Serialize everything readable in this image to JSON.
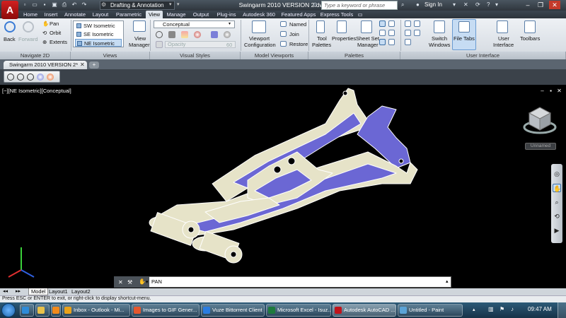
{
  "app": {
    "logo_letter": "A",
    "workspace": "Drafting & Annotation",
    "document_title": "Swingarm 2010 VERSION 2.dwg",
    "search_placeholder": "Type a keyword or phrase",
    "signin_label": "Sign In"
  },
  "ribbon_tabs": [
    "Home",
    "Insert",
    "Annotate",
    "Layout",
    "Parametric",
    "View",
    "Manage",
    "Output",
    "Plug-ins",
    "Autodesk 360",
    "Featured Apps",
    "Express Tools"
  ],
  "active_tab": "View",
  "ribbon": {
    "navigate": {
      "back": "Back",
      "forward": "Forward",
      "pan": "Pan",
      "orbit": "Orbit",
      "extents": "Extents",
      "title": "Navigate 2D"
    },
    "views": {
      "items": [
        "SW Isometric",
        "SE Isometric",
        "NE Isometric"
      ],
      "selected": "NE Isometric",
      "manager_line1": "View",
      "manager_line2": "Manager",
      "title": "Views"
    },
    "visual_styles": {
      "current": "Conceptual",
      "opacity_label": "Opacity",
      "opacity_value": "60",
      "title": "Visual Styles"
    },
    "model_viewports": {
      "config_line1": "Viewport",
      "config_line2": "Configuration",
      "named": "Named",
      "join": "Join",
      "restore": "Restore",
      "title": "Model Viewports"
    },
    "palettes": {
      "tool_line1": "Tool",
      "tool_line2": "Palettes",
      "properties": "Properties",
      "sheetset_line1": "Sheet Set",
      "sheetset_line2": "Manager",
      "title": "Palettes"
    },
    "user_interface": {
      "switch_line1": "Switch",
      "switch_line2": "Windows",
      "filetabs": "File Tabs",
      "ui_line1": "User",
      "ui_line2": "Interface",
      "toolbars": "Toolbars",
      "title": "User Interface"
    }
  },
  "file_tab": "Swingarm 2010 VERSION 2*",
  "viewport": {
    "label": "[−][NE Isometric][Conceptual]",
    "viewcube_label": "Unnamed"
  },
  "command": {
    "text": "PAN"
  },
  "layout_tabs": [
    "Model",
    "Layout1",
    "Layout2"
  ],
  "active_layout": "Model",
  "status_text": "Press ESC or ENTER to exit, or right-click to display shortcut-menu.",
  "taskbar": {
    "items": [
      {
        "label": "Inbox - Outlook - Mi...",
        "color": "#e9a21a"
      },
      {
        "label": "Images to GIF Gener...",
        "color": "#e4572e"
      },
      {
        "label": "Vuze Bittorrent Client",
        "color": "#2a7de1"
      },
      {
        "label": "Microsoft Excel - Isuz...",
        "color": "#1e7a3c"
      },
      {
        "label": "Autodesk AutoCAD ...",
        "color": "#c0141c"
      },
      {
        "label": "Untitled - Paint",
        "color": "#5ba3d6"
      }
    ],
    "clock": "09:47 AM"
  },
  "colors": {
    "model_purple": "#6b67d4",
    "model_cream": "#e6e3c8"
  }
}
